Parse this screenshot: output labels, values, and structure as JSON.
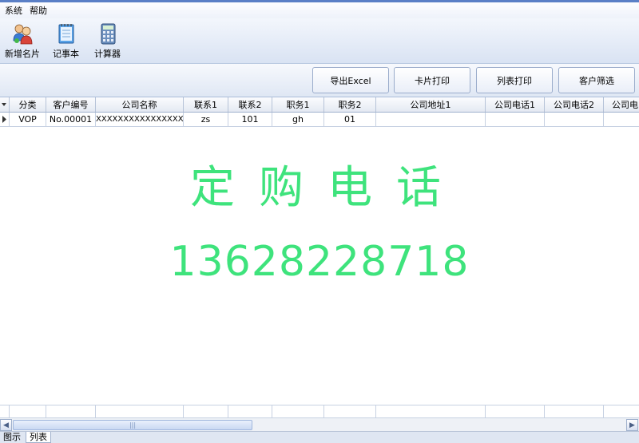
{
  "menu": [
    "系统",
    "帮助"
  ],
  "toolbar": [
    {
      "label": "新增名片",
      "icon": "contacts-icon"
    },
    {
      "label": "记事本",
      "icon": "notepad-icon"
    },
    {
      "label": "计算器",
      "icon": "calculator-icon"
    }
  ],
  "actions": [
    "导出Excel",
    "卡片打印",
    "列表打印",
    "客户筛选"
  ],
  "grid": {
    "columns": [
      "分类",
      "客户编号",
      "公司名称",
      "联系1",
      "联系2",
      "职务1",
      "职务2",
      "公司地址1",
      "公司电话1",
      "公司电话2",
      "公司电"
    ],
    "rows": [
      [
        "VOP",
        "No.00001",
        "XXXXXXXXXXXXXXXXXXXX",
        "zs",
        "101",
        "gh",
        "01",
        "",
        "",
        "",
        ""
      ]
    ]
  },
  "overlay": {
    "title": "定购电话",
    "phone": "13628228718"
  },
  "tabs": [
    "图示",
    "列表"
  ],
  "colors": {
    "overlay_text": "#3ee37c",
    "accent": "#5a7fc6"
  }
}
